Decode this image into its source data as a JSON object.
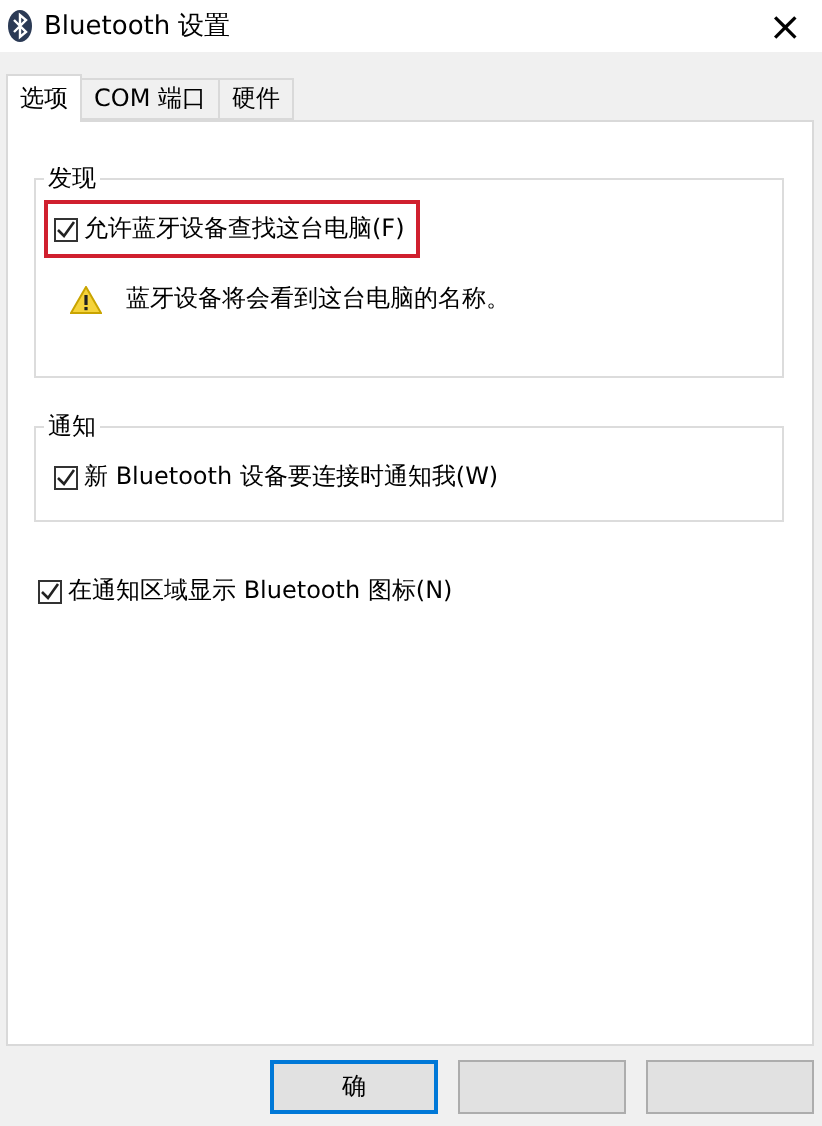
{
  "window": {
    "title": "Bluetooth 设置",
    "close": "×"
  },
  "tabs": [
    {
      "label": "选项",
      "selected": true
    },
    {
      "label": "COM 端口",
      "selected": false
    },
    {
      "label": "硬件",
      "selected": false
    }
  ],
  "groups": [
    {
      "title": "发现",
      "items": [
        {
          "kind": "checkbox",
          "label": "允许蓝牙设备查找这台电脑(F)",
          "checked": true,
          "highlighted": true
        },
        {
          "kind": "warning",
          "label": "蓝牙设备将会看到这台电脑的名称。"
        }
      ]
    },
    {
      "title": "通知",
      "items": [
        {
          "kind": "checkbox",
          "label": "新 Bluetooth 设备要连接时通知我(W)",
          "checked": true,
          "highlighted": false
        }
      ]
    }
  ],
  "options": [
    {
      "label": "在通知区域显示 Bluetooth 图标(N)",
      "checked": true
    }
  ],
  "buttons": [
    {
      "label": "确",
      "default": true
    },
    {
      "default": false
    },
    {
      "default": false
    }
  ]
}
